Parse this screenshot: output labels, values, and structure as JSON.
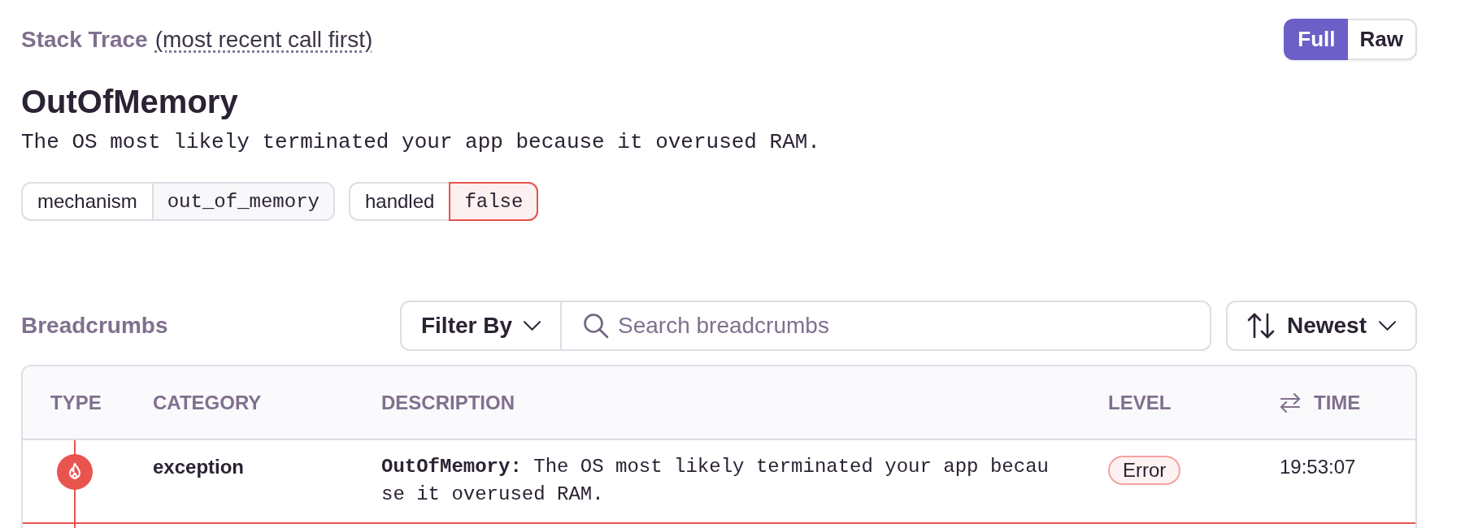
{
  "stack_trace": {
    "title": "Stack Trace",
    "note": "(most recent call first)",
    "view_toggle": [
      {
        "label": "Full",
        "selected": true
      },
      {
        "label": "Raw",
        "selected": false
      }
    ]
  },
  "exception": {
    "type": "OutOfMemory",
    "value": "The OS most likely terminated your app because it overused RAM.",
    "tags": [
      {
        "key": "mechanism",
        "value": "out_of_memory",
        "alert": false
      },
      {
        "key": "handled",
        "value": "false",
        "alert": true
      }
    ]
  },
  "breadcrumbs": {
    "title": "Breadcrumbs",
    "filter_button": "Filter By",
    "search": {
      "placeholder": "Search breadcrumbs"
    },
    "sort_button": "Newest",
    "table": {
      "columns": [
        {
          "label": "TYPE",
          "time_toggle": false
        },
        {
          "label": "CATEGORY",
          "time_toggle": false
        },
        {
          "label": "DESCRIPTION",
          "time_toggle": false
        },
        {
          "label": "LEVEL",
          "time_toggle": false
        },
        {
          "label": "TIME",
          "time_toggle": true
        }
      ],
      "rows": [
        {
          "kind": "exception",
          "color": "#e9544f",
          "category": "exception",
          "description": "**OutOfMemory:** The OS most likely terminated your app because it overused RAM.",
          "severity": "Error",
          "time": "19:53:07"
        }
      ]
    }
  }
}
